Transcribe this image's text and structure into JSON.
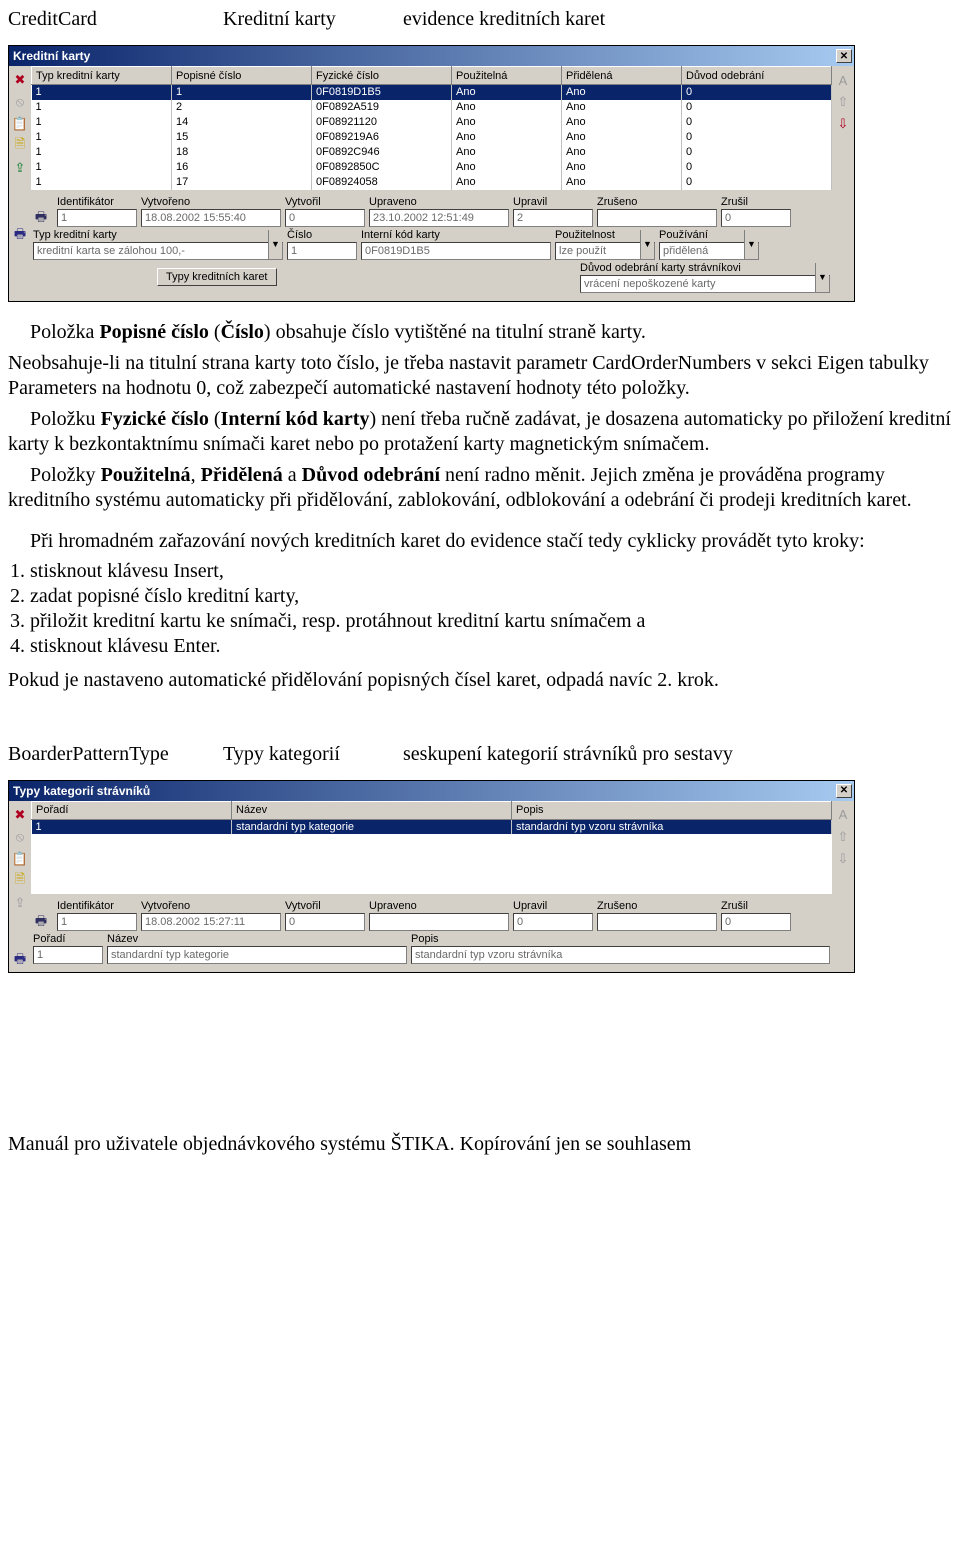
{
  "header1": {
    "c1": "CreditCard",
    "c2": "Kreditní karty",
    "c3": "evidence kreditních karet"
  },
  "win1": {
    "title": "Kreditní karty",
    "cols": [
      "Typ kreditní karty",
      "Popisné číslo",
      "Fyzické číslo",
      "Použitelná",
      "Přidělená",
      "Důvod odebrání"
    ],
    "rows": [
      {
        "c": [
          "1",
          "1",
          "0F0819D1B5",
          "Ano",
          "Ano",
          "0"
        ],
        "selected": true
      },
      {
        "c": [
          "1",
          "2",
          "0F0892A519",
          "Ano",
          "Ano",
          "0"
        ]
      },
      {
        "c": [
          "1",
          "14",
          "0F08921120",
          "Ano",
          "Ano",
          "0"
        ]
      },
      {
        "c": [
          "1",
          "15",
          "0F089219A6",
          "Ano",
          "Ano",
          "0"
        ]
      },
      {
        "c": [
          "1",
          "18",
          "0F0892C946",
          "Ano",
          "Ano",
          "0"
        ]
      },
      {
        "c": [
          "1",
          "16",
          "0F0892850C",
          "Ano",
          "Ano",
          "0"
        ]
      },
      {
        "c": [
          "1",
          "17",
          "0F08924058",
          "Ano",
          "Ano",
          "0"
        ]
      }
    ],
    "meta_labels": [
      "Identifikátor",
      "Vytvořeno",
      "Vytvořil",
      "Upraveno",
      "Upravil",
      "Zrušeno",
      "Zrušil"
    ],
    "meta_values": [
      "1",
      "18.08.2002 15:55:40",
      "0",
      "23.10.2002 12:51:49",
      "2",
      "",
      "0"
    ],
    "detail": {
      "typ_label": "Typ kreditní karty",
      "typ": "kreditní karta se zálohou 100,-",
      "cislo_label": "Číslo",
      "cislo": "1",
      "interni_label": "Interní kód karty",
      "interni": "0F0819D1B5",
      "pouzitelnost_label": "Použitelnost",
      "pouzitelnost": "lze použít",
      "pouzivani_label": "Používání",
      "pouzivani": "přidělená",
      "typy_btn": "Typy kreditních karet",
      "duvod_label": "Důvod odebrání karty strávníkovi",
      "duvod": "vrácení nepoškozené karty"
    }
  },
  "body": {
    "p1_a": "Položka ",
    "p1_b": "Popisné číslo",
    "p1_c": " (",
    "p1_d": "Číslo",
    "p1_e": ") obsahuje číslo vytištěné na titulní straně karty.",
    "p2": "Neobsahuje-li na titulní strana karty toto číslo, je třeba nastavit parametr CardOrderNumbers v sekci Eigen tabulky Parameters na hodnotu 0, což zabezpečí automatické nastavení hodnoty této položky.",
    "p3_a": "Položku ",
    "p3_b": "Fyzické číslo",
    "p3_c": " (",
    "p3_d": "Interní kód karty",
    "p3_e": ") není třeba ručně zadávat, je dosazena automaticky po přiložení kreditní karty k bezkontaktnímu snímači karet nebo po protažení karty magnetickým snímačem.",
    "p4_a": "Položky ",
    "p4_b": "Použitelná",
    "p4_c": ", ",
    "p4_d": "Přidělená",
    "p4_e": " a ",
    "p4_f": "Důvod odebrání",
    "p4_g": " není radno měnit. Jejich změna je prováděna programy kreditního systému automaticky při přidělování, zablokování, odblokování a odebrání či prodeji kreditních karet.",
    "p5": "Při hromadném zařazování nových kreditních karet do evidence stačí tedy cyklicky provádět tyto kroky:",
    "steps": [
      "stisknout klávesu Insert,",
      "zadat popisné číslo kreditní karty,",
      "přiložit kreditní kartu ke snímači, resp. protáhnout kreditní kartu snímačem a",
      "stisknout klávesu Enter."
    ],
    "p6": "Pokud je nastaveno automatické přidělování popisných čísel karet, odpadá navíc 2. krok."
  },
  "header2": {
    "c1": "BoarderPatternType",
    "c2": "Typy kategorií",
    "c3": "seskupení kategorií strávníků pro sestavy"
  },
  "win2": {
    "title": "Typy kategorií strávníků",
    "cols": [
      "Pořadí",
      "Název",
      "Popis"
    ],
    "rows": [
      {
        "c": [
          "1",
          "standardní typ kategorie",
          "standardní typ vzoru strávníka"
        ],
        "selected": true
      }
    ],
    "meta_labels": [
      "Identifikátor",
      "Vytvořeno",
      "Vytvořil",
      "Upraveno",
      "Upravil",
      "Zrušeno",
      "Zrušil"
    ],
    "meta_values": [
      "1",
      "18.08.2002 15:27:11",
      "0",
      "",
      "0",
      "",
      "0"
    ],
    "detail": {
      "poradi_label": "Pořadí",
      "poradi": "1",
      "nazev_label": "Název",
      "nazev": "standardní typ kategorie",
      "popis_label": "Popis",
      "popis": "standardní typ vzoru strávníka"
    }
  },
  "footer": "Manuál pro uživatele objednávkového systému ŠTIKA. Kopírování jen se souhlasem"
}
